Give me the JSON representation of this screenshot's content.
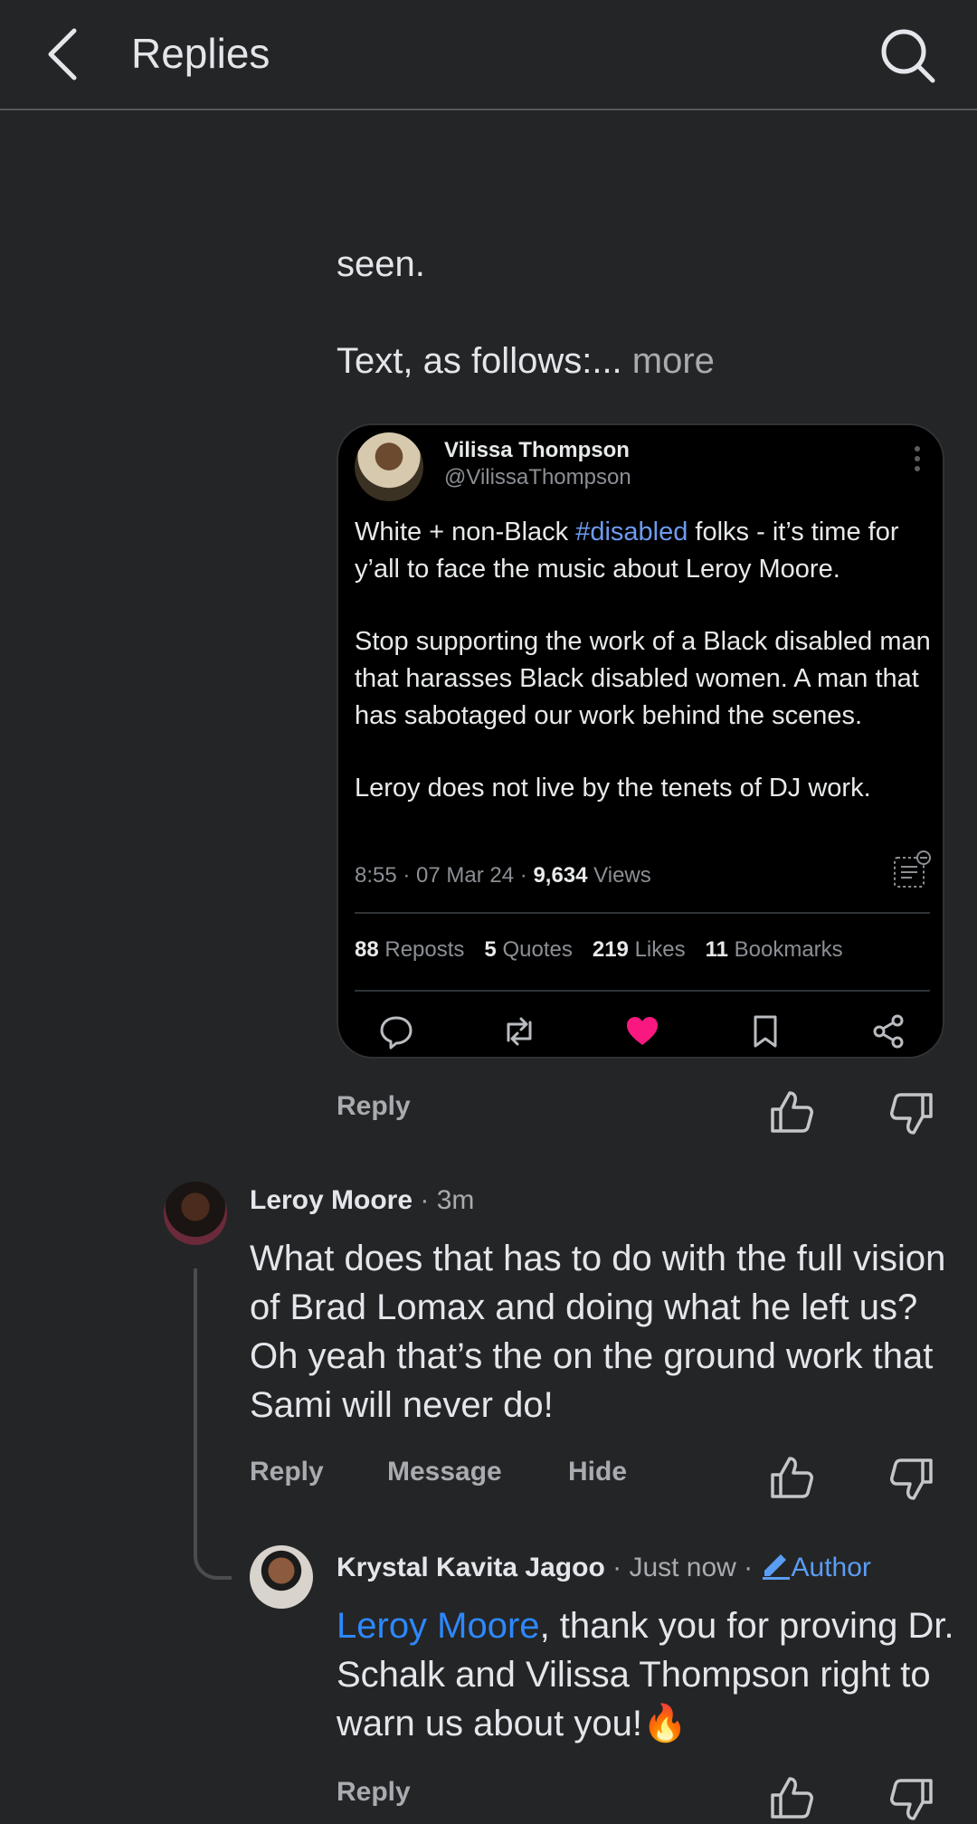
{
  "header": {
    "title": "Replies"
  },
  "post": {
    "text_line1": "seen.",
    "text_line2": "Text, as follows:...",
    "more_label": "more"
  },
  "embed": {
    "author_name": "Vilissa Thompson",
    "author_handle": "@VilissaThompson",
    "body_p1_before": "White + non-Black ",
    "body_p1_hashtag": "#disabled",
    "body_p1_after": " folks - it’s time for y’all to face the music about Leroy Moore.",
    "body_p2": "Stop supporting the work of a Black disabled man that harasses Black disabled women. A man that has sabotaged our work behind the scenes.",
    "body_p3": "Leroy does not live by the tenets of DJ work.",
    "timestamp": "8:55 · 07 Mar 24 · ",
    "views_count": "9,634",
    "views_label": " Views",
    "stats": [
      {
        "count": "88",
        "label": "Reposts"
      },
      {
        "count": "5",
        "label": "Quotes"
      },
      {
        "count": "219",
        "label": "Likes"
      },
      {
        "count": "11",
        "label": "Bookmarks"
      }
    ],
    "like_color": "#f91880"
  },
  "post_actions": {
    "reply": "Reply"
  },
  "comments": [
    {
      "name": "Leroy Moore",
      "time": " · 3m",
      "text": "What does that has to do with the full vision of Brad Lomax and doing what he left us?  Oh yeah that’s the on the ground work that Sami will never do!",
      "actions": {
        "reply": "Reply",
        "message": "Message",
        "hide": "Hide"
      }
    },
    {
      "name": "Krystal Kavita Jagoo",
      "time": " · Just now · ",
      "badge": "Author",
      "mention": "Leroy Moore",
      "text": ", thank you for proving Dr. Schalk and Vilissa Thompson right to warn us about you!🔥",
      "actions": {
        "reply": "Reply"
      }
    }
  ]
}
